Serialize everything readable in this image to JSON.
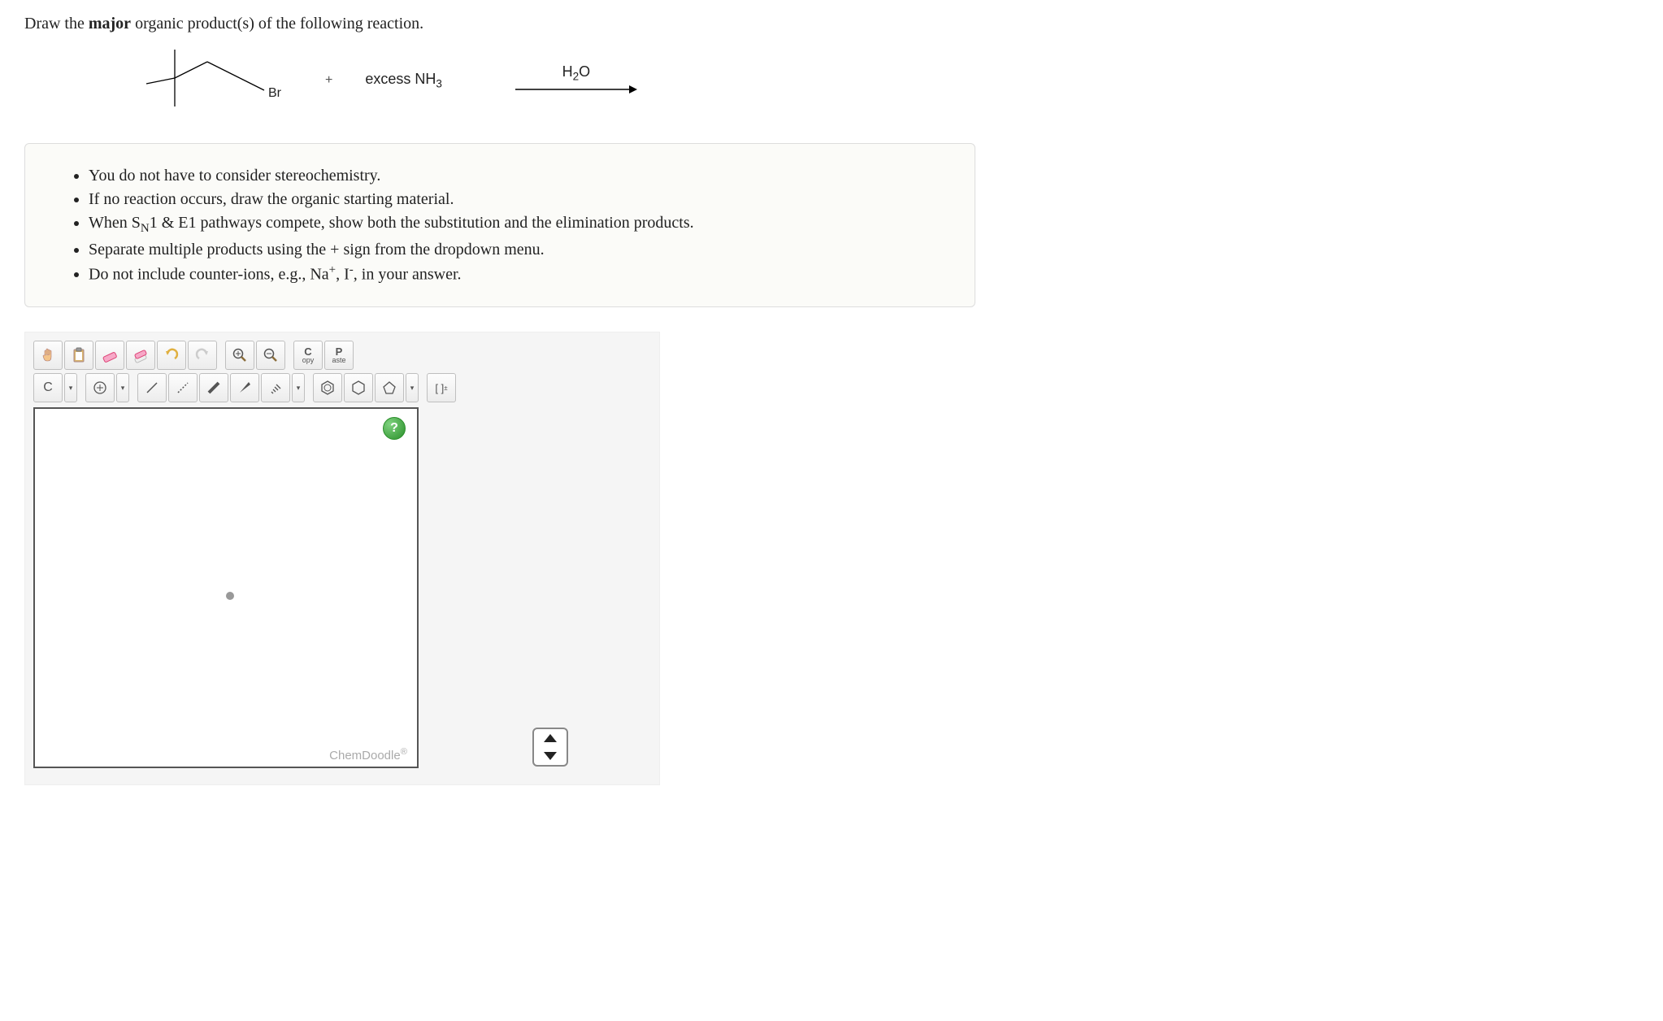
{
  "prompt_prefix": "Draw the ",
  "prompt_bold": "major",
  "prompt_suffix": " organic product(s) of the following reaction.",
  "reaction": {
    "molecule_label_Br": "Br",
    "plus": "+",
    "reagent": "excess NH",
    "reagent_sub": "3",
    "arrow_label_main": "H",
    "arrow_label_sub": "2",
    "arrow_label_tail": "O"
  },
  "instructions": {
    "i1": "You do not have to consider stereochemistry.",
    "i2": "If no reaction occurs, draw the organic starting material.",
    "i3_a": "When S",
    "i3_sub": "N",
    "i3_b": "1 & E1 pathways compete, show both the substitution and the elimination products.",
    "i4": "Separate multiple products using the + sign from the dropdown menu.",
    "i5_a": "Do not include counter-ions, e.g., Na",
    "i5_sup1": "+",
    "i5_b": ", I",
    "i5_sup2": "-",
    "i5_c": ", in your answer."
  },
  "toolbar1": {
    "hand": "✋",
    "lasso": "📋",
    "eraser": " ",
    "undo": "↶",
    "redo": "↷",
    "zoom_in": "＋",
    "zoom_out": "－",
    "copy_top": "C",
    "copy_bot": "opy",
    "paste_top": "P",
    "paste_bot": "aste"
  },
  "toolbar2": {
    "atom_c": "C",
    "charge": "⊕",
    "bond_single": "/",
    "bond_recessed": "⋰",
    "bond_bold": "▰",
    "bond_wedge": "◢",
    "bond_hash": "⫽",
    "ring_benzene": "⬡",
    "ring_cyclohexane": "⬡",
    "ring_cyclopentane": "⬠",
    "bracket": "[ ]",
    "bracket_sup": "±"
  },
  "canvas": {
    "help": "?",
    "brand": "ChemDoodle",
    "brand_sup": "®"
  }
}
